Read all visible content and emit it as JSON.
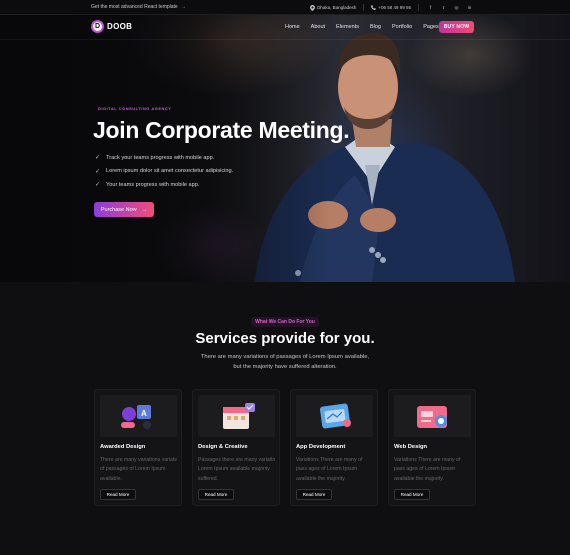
{
  "topbar": {
    "announcement": "Get the most advanced React template",
    "announcement_arrow": "→",
    "location": "Dhaka, Bangladesh",
    "phone": "+06 58 49 99 56",
    "socials": [
      "facebook-icon",
      "twitter-icon",
      "instagram-icon",
      "linkedin-icon"
    ],
    "social_glyphs": [
      "f",
      "t",
      "◎",
      "in"
    ]
  },
  "header": {
    "logo_mark": "D",
    "logo_text": "DOOB",
    "nav": [
      "Home",
      "About",
      "Elements",
      "Blog",
      "Portfolio",
      "Pages"
    ],
    "buy_button": "BUY NOW"
  },
  "hero": {
    "tag": "DIGITAL CONSULTING AGENCY",
    "title": "Join Corporate Meeting.",
    "bullets": [
      "Track your teams progress with mobile app.",
      "Lorem ipsum dolor sit amet consectetur adipisicing.",
      "Your teams progress with mobile app."
    ],
    "cta": "Purchase Now",
    "cta_arrow": "→"
  },
  "services": {
    "badge": "What We Can Do For You",
    "title": "Services provide for you.",
    "desc_line1": "There are many variations of passages of Lorem Ipsum available,",
    "desc_line2": "but the majority have suffered alteration.",
    "cards": [
      {
        "title": "Awarded Design",
        "text": "There are many variations variats of passages of Lorem Ipsum available.",
        "button": "Read More"
      },
      {
        "title": "Design & Creative",
        "text": "Passages there are many variatin Lorem Ipsum available majority suffered.",
        "button": "Read More"
      },
      {
        "title": "App Development",
        "text": "Variations There are many of pass ages of Lorem Ipsum available the majority.",
        "button": "Read More"
      },
      {
        "title": "Web Design",
        "text": "Variations There are many of pass ages of Lorem Ipsum available the majority.",
        "button": "Read More"
      }
    ]
  },
  "colors": {
    "accent_pink": "#f14b74",
    "accent_purple": "#8b3fd8",
    "tag_purple": "#c55fd6",
    "background": "#0f0f11"
  }
}
